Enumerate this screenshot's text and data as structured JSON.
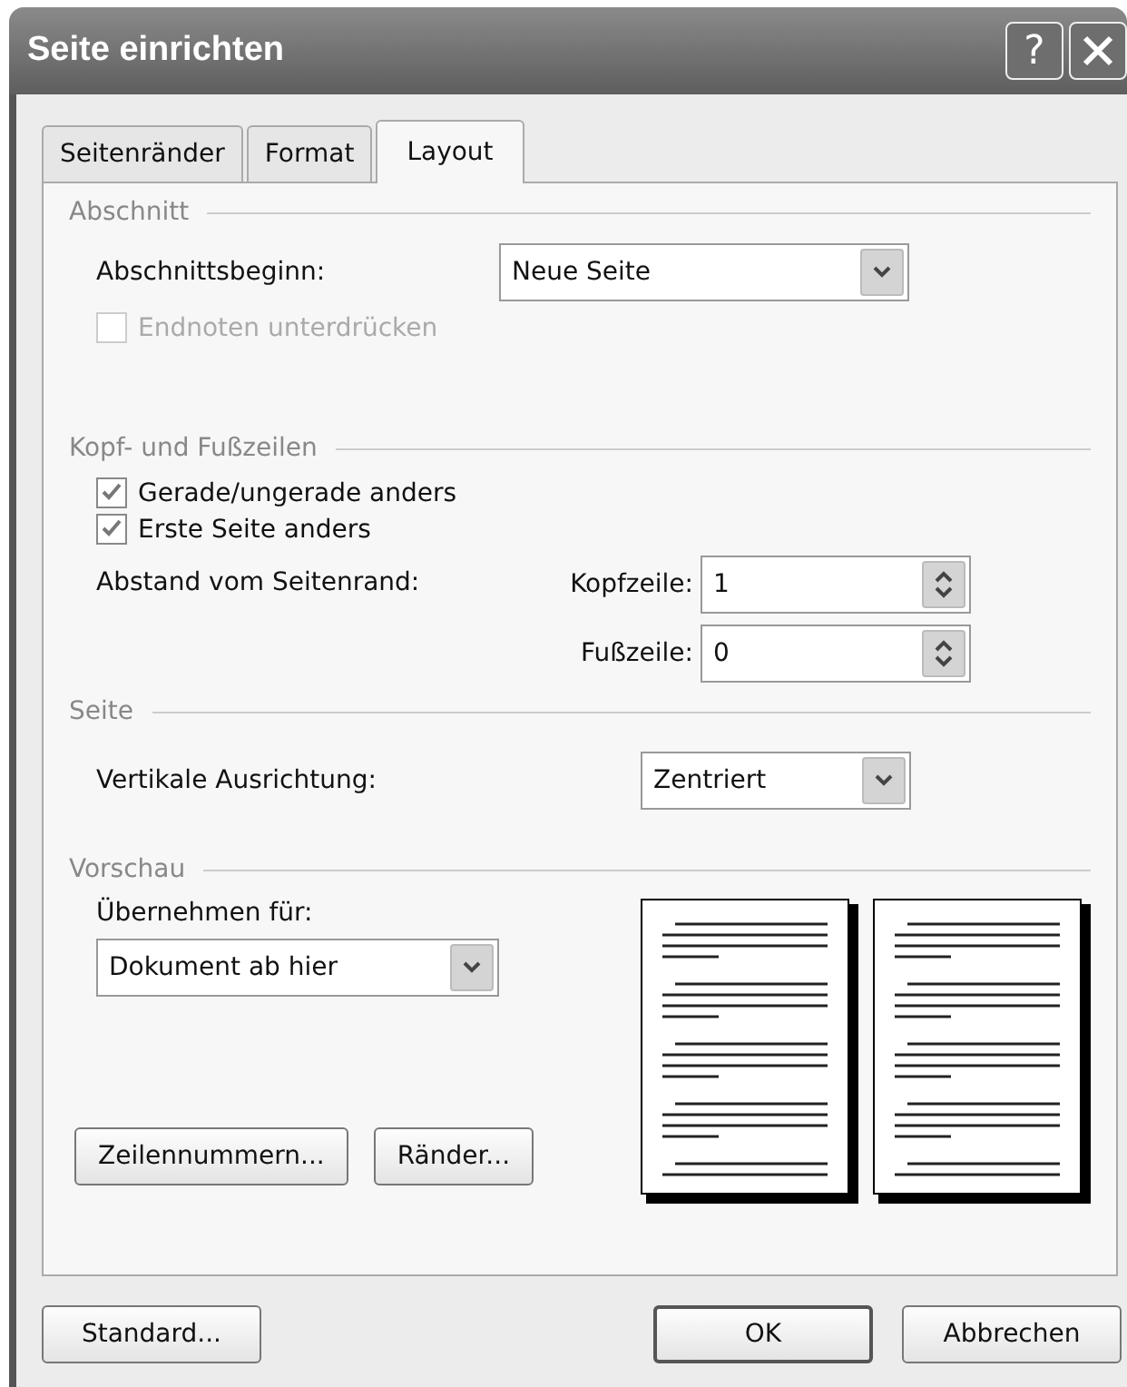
{
  "window": {
    "title": "Seite einrichten",
    "help": "?"
  },
  "tabs": [
    {
      "label": "Seitenränder",
      "selected": false
    },
    {
      "label": "Format",
      "selected": false
    },
    {
      "label": "Layout",
      "selected": true
    }
  ],
  "section": {
    "heading": "Abschnitt",
    "start_label": {
      "text": "Abschnittsbeginn:"
    },
    "start_value": "Neue Seite",
    "endnotes": {
      "label": "Endnoten unterdrücken",
      "checked": false,
      "disabled": true
    }
  },
  "header_footer": {
    "heading": "Kopf- und Fußzeilen",
    "options": [
      {
        "label": "Gerade/ungerade anders",
        "checked": true,
        "disabled": false
      },
      {
        "label": "Erste Seite anders",
        "checked": true,
        "disabled": false
      }
    ],
    "distance_label": "Abstand vom Seitenrand:",
    "fields": [
      {
        "label": "Kopfzeile:",
        "value": "1"
      },
      {
        "label": "Fußzeile:",
        "value": "0"
      }
    ]
  },
  "page": {
    "heading": "Seite",
    "alignment_label": {
      "text": "Vertikale Ausrichtung:"
    },
    "alignment_value": "Zentriert"
  },
  "preview": {
    "heading": "Vorschau",
    "apply_label": {
      "text": "Übernehmen für:"
    },
    "apply_value": "Dokument ab hier",
    "buttons": [
      {
        "label": "Zeilennummern..."
      },
      {
        "label": "Ränder..."
      }
    ]
  },
  "footer_buttons": [
    {
      "label": "Standard...",
      "default": false
    },
    {
      "label": "OK",
      "default": true
    },
    {
      "label": "Abbrechen",
      "default": false
    }
  ]
}
